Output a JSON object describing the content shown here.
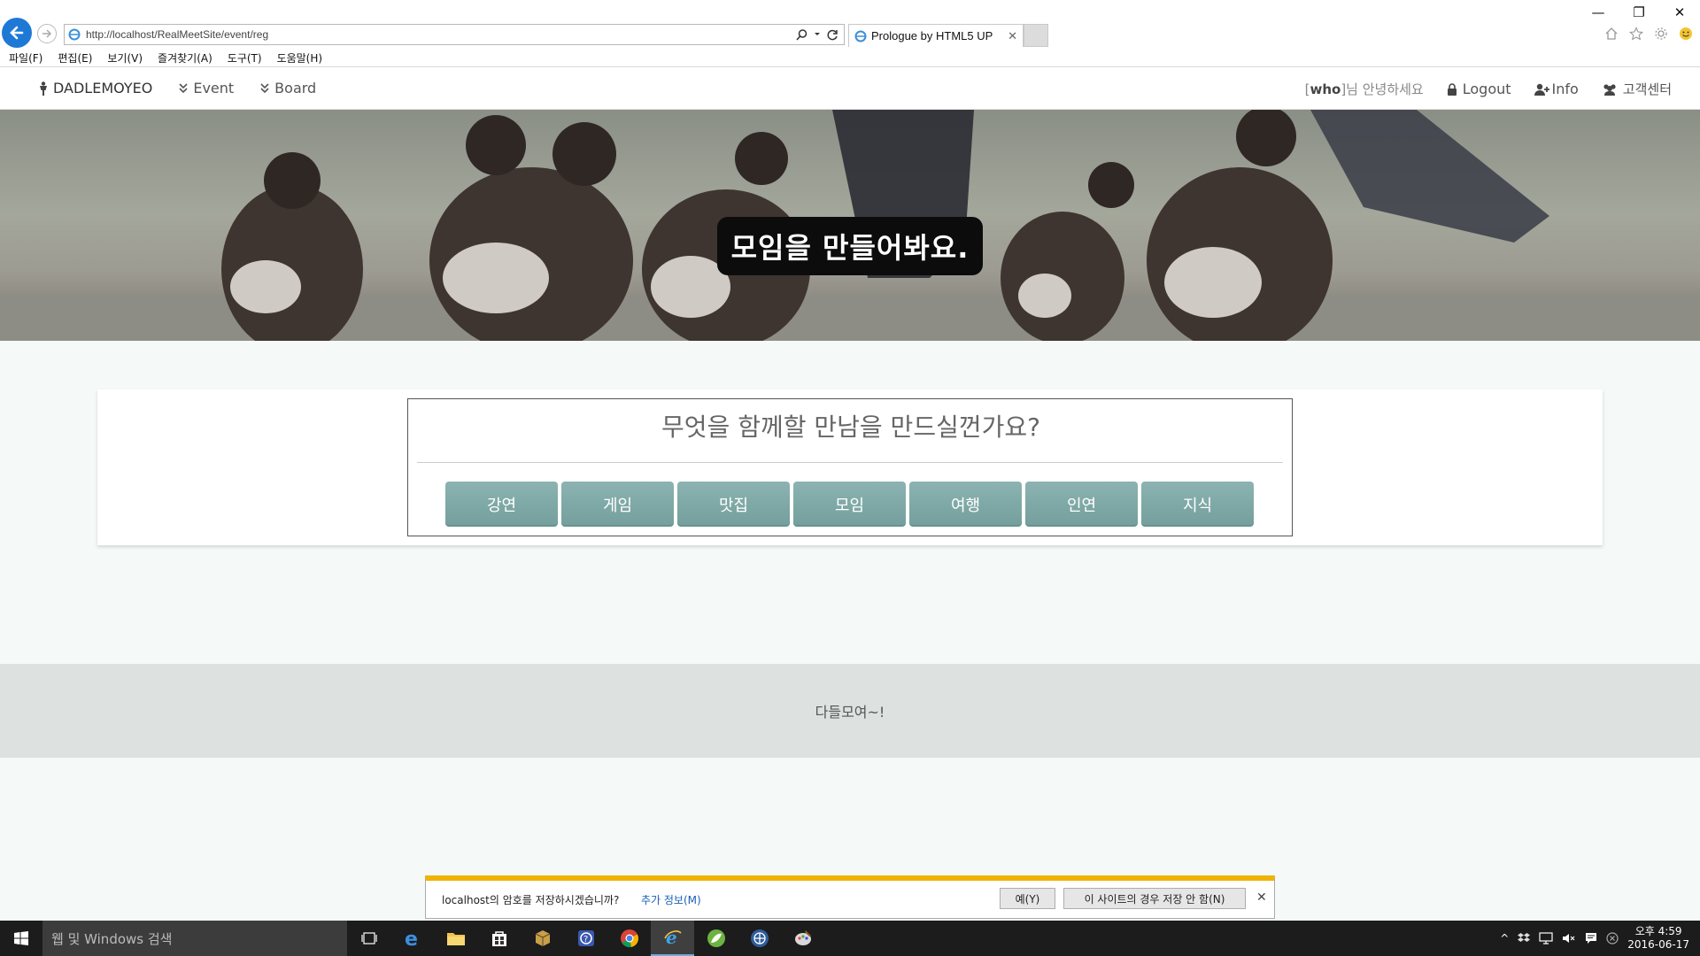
{
  "browser": {
    "url": "http://localhost/RealMeetSite/event/reg",
    "tab_title": "Prologue by HTML5 UP",
    "menu": [
      "파일(F)",
      "편집(E)",
      "보기(V)",
      "즐겨찾기(A)",
      "도구(T)",
      "도움말(H)"
    ]
  },
  "nav": {
    "brand": "DADLEMOYEO",
    "event": "Event",
    "board": "Board",
    "greeting_prefix": "[",
    "greeting_user": "who",
    "greeting_suffix": "]님 안녕하세요",
    "logout": "Logout",
    "info": "Info",
    "support": "고객센터"
  },
  "hero": {
    "title": "모임을 만들어봐요."
  },
  "main": {
    "question": "무엇을 함께할 만남을 만드실껀가요?",
    "categories": [
      "강연",
      "게임",
      "맛집",
      "모임",
      "여행",
      "인연",
      "지식"
    ]
  },
  "footer": {
    "text": "다들모여~!"
  },
  "password_bar": {
    "message": "localhost의 암호를 저장하시겠습니까?",
    "more": "추가 정보(M)",
    "yes": "예(Y)",
    "never": "이 사이트의 경우 저장 안 함(N)"
  },
  "taskbar": {
    "search_placeholder": "웹 및 Windows 검색",
    "time": "오후 4:59",
    "date": "2016-06-17"
  },
  "colors": {
    "category_button": "#7fa9a7",
    "footer_bg": "#dde2e1",
    "pwbar_accent": "#f0b400",
    "back_button": "#1e79d6"
  }
}
